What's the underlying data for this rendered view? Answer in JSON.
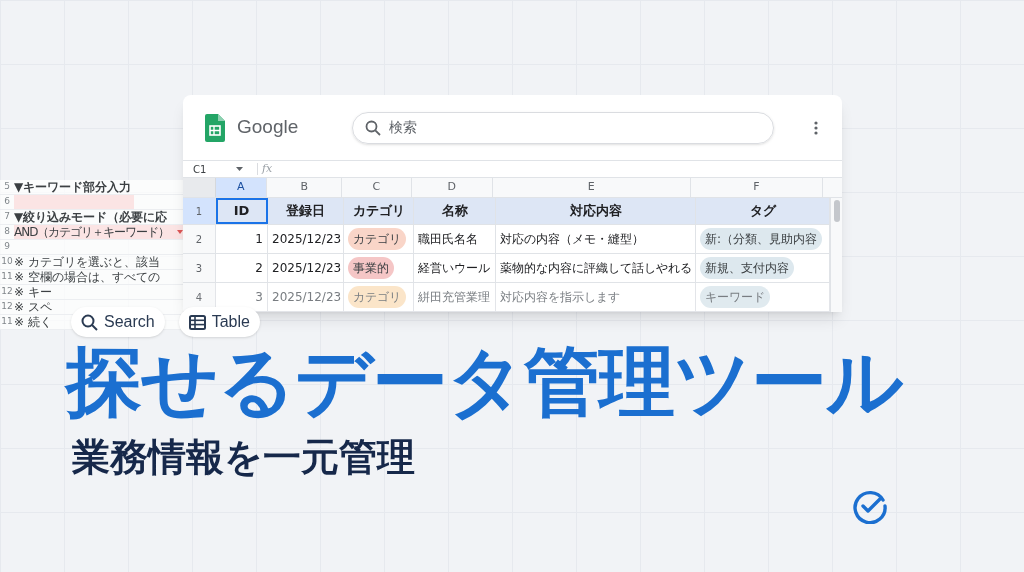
{
  "background_sheet": {
    "rows": [
      {
        "number": "5",
        "text": "▼キーワード部分入力",
        "kind": "heading"
      },
      {
        "number": "6",
        "text": "",
        "kind": "input"
      },
      {
        "number": "7",
        "text": "▼絞り込みモード（必要に応",
        "kind": "heading"
      },
      {
        "number": "8",
        "text": "AND（カテゴリ＋キーワード）",
        "kind": "select"
      },
      {
        "number": "9",
        "text": "",
        "kind": "plain"
      },
      {
        "number": "10",
        "text": "※ カテゴリを選ぶと、該当",
        "kind": "plain"
      },
      {
        "number": "11",
        "text": "※ 空欄の場合は、すべての",
        "kind": "plain"
      },
      {
        "number": "12",
        "text": "※ キー",
        "kind": "plain"
      },
      {
        "number": "12",
        "text": "※ スペ",
        "kind": "plain"
      },
      {
        "number": "11",
        "text": "※ 続く",
        "kind": "plain"
      }
    ]
  },
  "window": {
    "app_name": "Google",
    "search": {
      "placeholder": "検索"
    },
    "name_box": "C1",
    "formula_label": "fx",
    "columns": [
      {
        "label": "A",
        "selected": true
      },
      {
        "label": "B",
        "selected": false
      },
      {
        "label": "C",
        "selected": false
      },
      {
        "label": "D",
        "selected": false
      },
      {
        "label": "E",
        "selected": false
      },
      {
        "label": "F",
        "selected": false
      }
    ],
    "rows": [
      {
        "number": "1",
        "faded": false,
        "header": true,
        "cells": [
          {
            "text": "ID",
            "selected": true
          },
          {
            "text": "登録日",
            "selected": false
          },
          {
            "text": "カテゴリ",
            "selected": false
          },
          {
            "text": "名称",
            "selected": false
          },
          {
            "text": "対応内容",
            "selected": false
          },
          {
            "text": "タグ",
            "selected": false
          }
        ]
      },
      {
        "number": "2",
        "faded": false,
        "header": false,
        "cells": [
          {
            "text": "1",
            "selected": false
          },
          {
            "text": "2025/12/23",
            "selected": false
          },
          {
            "text": "カテゴリ",
            "kind": "pill",
            "color": "#f9d5c8",
            "selected": false
          },
          {
            "text": "職田氏名名",
            "selected": false
          },
          {
            "text": "対応の内容（メモ・縫型）",
            "selected": false
          },
          {
            "text": "新:（分類、見助内容",
            "kind": "pill",
            "color": "#dde8ee",
            "selected": false
          }
        ]
      },
      {
        "number": "3",
        "faded": false,
        "header": false,
        "cells": [
          {
            "text": "2",
            "selected": false
          },
          {
            "text": "2025/12/23",
            "selected": false
          },
          {
            "text": "事業的",
            "kind": "pill",
            "color": "#f5c6c6",
            "selected": false
          },
          {
            "text": "経営いウール",
            "selected": false
          },
          {
            "text": "薬物的な内容に評織して話しやれる",
            "selected": false
          },
          {
            "text": "新規、支付内容",
            "kind": "pill",
            "color": "#dde8ee",
            "selected": false
          }
        ]
      },
      {
        "number": "4",
        "faded": true,
        "header": false,
        "cells": [
          {
            "text": "3",
            "selected": false
          },
          {
            "text": "2025/12/23",
            "selected": false
          },
          {
            "text": "カテゴリ",
            "kind": "pill",
            "color": "#fbe3c4",
            "selected": false
          },
          {
            "text": "絣田充管業理",
            "selected": false
          },
          {
            "text": "対応内容を指示します",
            "selected": false
          },
          {
            "text": "キーワード",
            "kind": "pill",
            "color": "#dde8ee",
            "selected": false
          }
        ]
      }
    ]
  },
  "chips": [
    {
      "label": "Search",
      "kind": "search"
    },
    {
      "label": "Table",
      "kind": "table"
    }
  ],
  "title": "探せるデータ管理ツール",
  "subtitle": "業務情報を一元管理"
}
